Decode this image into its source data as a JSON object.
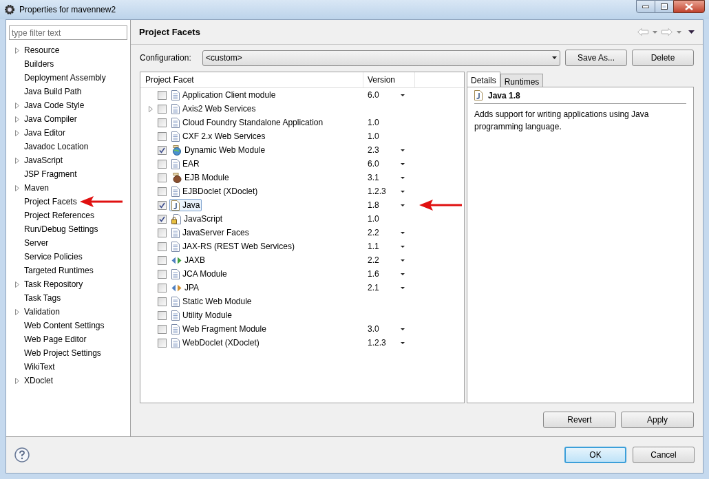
{
  "window": {
    "title": "Properties for mavennew2"
  },
  "sidebar": {
    "filter_placeholder": "type filter text",
    "items": [
      {
        "label": "Resource",
        "expandable": true
      },
      {
        "label": "Builders",
        "expandable": false
      },
      {
        "label": "Deployment Assembly",
        "expandable": false
      },
      {
        "label": "Java Build Path",
        "expandable": false
      },
      {
        "label": "Java Code Style",
        "expandable": true
      },
      {
        "label": "Java Compiler",
        "expandable": true
      },
      {
        "label": "Java Editor",
        "expandable": true
      },
      {
        "label": "Javadoc Location",
        "expandable": false
      },
      {
        "label": "JavaScript",
        "expandable": true
      },
      {
        "label": "JSP Fragment",
        "expandable": false
      },
      {
        "label": "Maven",
        "expandable": true
      },
      {
        "label": "Project Facets",
        "expandable": false,
        "annotated": true
      },
      {
        "label": "Project References",
        "expandable": false
      },
      {
        "label": "Run/Debug Settings",
        "expandable": false
      },
      {
        "label": "Server",
        "expandable": false
      },
      {
        "label": "Service Policies",
        "expandable": false
      },
      {
        "label": "Targeted Runtimes",
        "expandable": false
      },
      {
        "label": "Task Repository",
        "expandable": true
      },
      {
        "label": "Task Tags",
        "expandable": false
      },
      {
        "label": "Validation",
        "expandable": true
      },
      {
        "label": "Web Content Settings",
        "expandable": false
      },
      {
        "label": "Web Page Editor",
        "expandable": false
      },
      {
        "label": "Web Project Settings",
        "expandable": false
      },
      {
        "label": "WikiText",
        "expandable": false
      },
      {
        "label": "XDoclet",
        "expandable": true
      }
    ]
  },
  "page": {
    "title": "Project Facets",
    "configuration_label": "Configuration:",
    "configuration_value": "<custom>",
    "buttons": [
      "Save As...",
      "Delete"
    ]
  },
  "facets": {
    "columns": [
      "Project Facet",
      "Version"
    ],
    "rows": [
      {
        "name": "Application Client module",
        "kind": "page",
        "version": "6.0",
        "dropdown": true,
        "checked": false,
        "expandable": false,
        "selected": false
      },
      {
        "name": "Axis2 Web Services",
        "kind": "page",
        "dropdown": false,
        "checked": false,
        "expandable": true,
        "selected": false
      },
      {
        "name": "Cloud Foundry Standalone Application",
        "kind": "page",
        "version": "1.0",
        "dropdown": false,
        "checked": false,
        "expandable": false,
        "selected": false
      },
      {
        "name": "CXF 2.x Web Services",
        "kind": "page",
        "version": "1.0",
        "dropdown": false,
        "checked": false,
        "expandable": false,
        "selected": false
      },
      {
        "name": "Dynamic Web Module",
        "kind": "globe",
        "version": "2.3",
        "dropdown": true,
        "checked": true,
        "expandable": false,
        "selected": false
      },
      {
        "name": "EAR",
        "kind": "page",
        "version": "6.0",
        "dropdown": true,
        "checked": false,
        "expandable": false,
        "selected": false
      },
      {
        "name": "EJB Module",
        "kind": "bean",
        "version": "3.1",
        "dropdown": true,
        "checked": false,
        "expandable": false,
        "selected": false
      },
      {
        "name": "EJBDoclet (XDoclet)",
        "kind": "page",
        "version": "1.2.3",
        "dropdown": true,
        "checked": false,
        "expandable": false,
        "selected": false
      },
      {
        "name": "Java",
        "kind": "java",
        "version": "1.8",
        "dropdown": true,
        "checked": true,
        "expandable": false,
        "selected": true,
        "annotated": true
      },
      {
        "name": "JavaScript",
        "kind": "locked",
        "version": "1.0",
        "dropdown": false,
        "checked": true,
        "expandable": false,
        "selected": false
      },
      {
        "name": "JavaServer Faces",
        "kind": "page",
        "version": "2.2",
        "dropdown": true,
        "checked": false,
        "expandable": false,
        "selected": false
      },
      {
        "name": "JAX-RS (REST Web Services)",
        "kind": "page",
        "version": "1.1",
        "dropdown": true,
        "checked": false,
        "expandable": false,
        "selected": false
      },
      {
        "name": "JAXB",
        "kind": "binding",
        "version": "2.2",
        "dropdown": true,
        "checked": false,
        "expandable": false,
        "selected": false
      },
      {
        "name": "JCA Module",
        "kind": "page",
        "version": "1.6",
        "dropdown": true,
        "checked": false,
        "expandable": false,
        "selected": false
      },
      {
        "name": "JPA",
        "kind": "persistence",
        "version": "2.1",
        "dropdown": true,
        "checked": false,
        "expandable": false,
        "selected": false
      },
      {
        "name": "Static Web Module",
        "kind": "page",
        "dropdown": false,
        "checked": false,
        "expandable": false,
        "selected": false
      },
      {
        "name": "Utility Module",
        "kind": "page",
        "dropdown": false,
        "checked": false,
        "expandable": false,
        "selected": false
      },
      {
        "name": "Web Fragment Module",
        "kind": "page",
        "version": "3.0",
        "dropdown": true,
        "checked": false,
        "expandable": false,
        "selected": false
      },
      {
        "name": "WebDoclet (XDoclet)",
        "kind": "page",
        "version": "1.2.3",
        "dropdown": true,
        "checked": false,
        "expandable": false,
        "selected": false
      }
    ]
  },
  "details": {
    "tabs": [
      {
        "label": "Details",
        "selected": true
      },
      {
        "label": "Runtimes",
        "selected": false
      }
    ],
    "heading": "Java 1.8",
    "description": "Adds support for writing applications using Java programming language."
  },
  "page_buttons": [
    "Revert",
    "Apply"
  ],
  "dialog_buttons": [
    {
      "label": "OK",
      "default": true
    },
    {
      "label": "Cancel",
      "default": false
    }
  ]
}
